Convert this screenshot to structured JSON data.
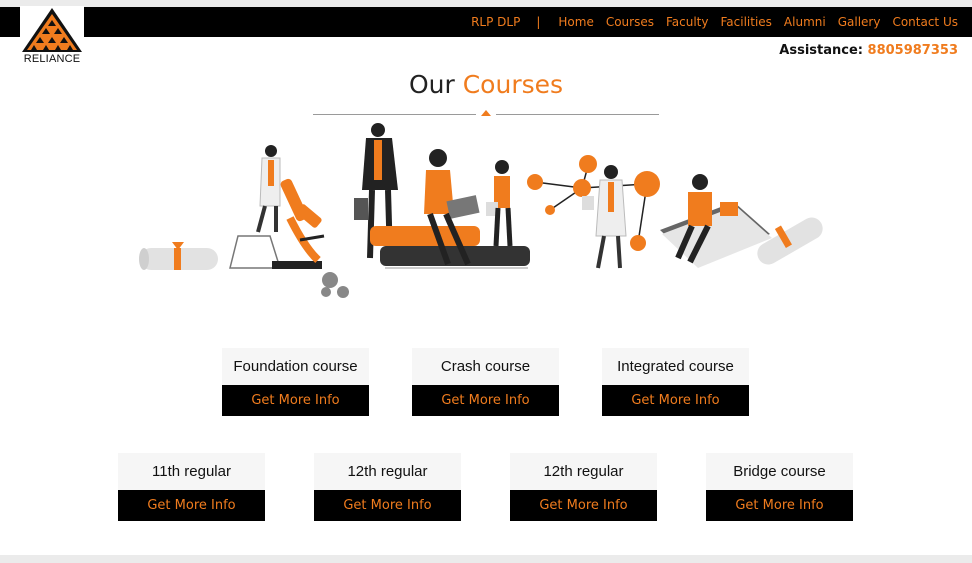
{
  "brand": {
    "name": "RELIANCE",
    "color_accent": "#f07c1e",
    "color_dark": "#000000"
  },
  "nav": {
    "items": [
      {
        "label": "RLP DLP"
      },
      {
        "label": "Home"
      },
      {
        "label": "Courses"
      },
      {
        "label": "Faculty"
      },
      {
        "label": "Facilities"
      },
      {
        "label": "Alumni"
      },
      {
        "label": "Gallery"
      },
      {
        "label": "Contact Us"
      }
    ],
    "separator": "|"
  },
  "assistance": {
    "label": "Assistance:",
    "phone": "8805987353"
  },
  "section": {
    "title_prefix": "Our",
    "title_accent": "Courses"
  },
  "courses": [
    {
      "title": "Foundation course",
      "button": "Get More Info"
    },
    {
      "title": "Crash course",
      "button": "Get More Info"
    },
    {
      "title": "Integrated course",
      "button": "Get More Info"
    },
    {
      "title": "11th regular",
      "button": "Get More Info"
    },
    {
      "title": "12th regular",
      "button": "Get More Info"
    },
    {
      "title": "12th regular",
      "button": "Get More Info"
    },
    {
      "title": "Bridge course",
      "button": "Get More Info"
    }
  ]
}
